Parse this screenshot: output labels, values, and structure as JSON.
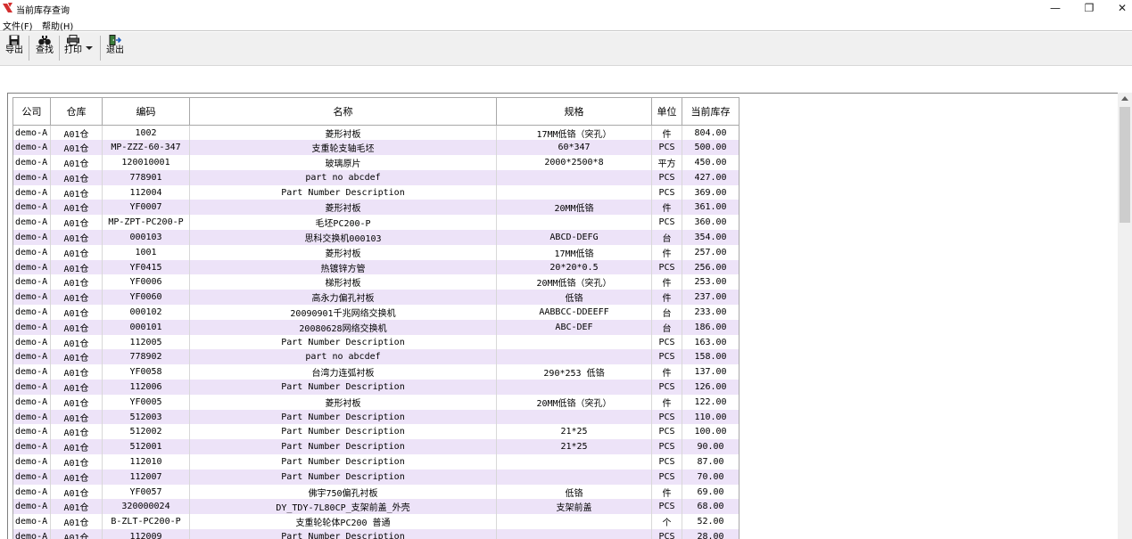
{
  "window": {
    "title": "当前库存查询",
    "minimize": "—",
    "maximize": "❐",
    "close": "✕"
  },
  "menu": [
    {
      "label": "文件(F)"
    },
    {
      "label": "帮助(H)"
    }
  ],
  "toolbar": {
    "export_label": "导出",
    "find_label": "查找",
    "print_label": "打印",
    "exit_label": "退出"
  },
  "table": {
    "columns": [
      "公司",
      "仓库",
      "编码",
      "名称",
      "规格",
      "单位",
      "当前库存"
    ],
    "rows": [
      [
        "demo-A",
        "A01仓",
        "1002",
        "菱形衬板",
        "17MM低铬（突孔）",
        "件",
        "804.00"
      ],
      [
        "demo-A",
        "A01仓",
        "MP-ZZZ-60-347",
        "支重轮支轴毛坯",
        "60*347",
        "PCS",
        "500.00"
      ],
      [
        "demo-A",
        "A01仓",
        "120010001",
        "玻璃原片",
        "2000*2500*8",
        "平方",
        "450.00"
      ],
      [
        "demo-A",
        "A01仓",
        "778901",
        "part no abcdef",
        "",
        "PCS",
        "427.00"
      ],
      [
        "demo-A",
        "A01仓",
        "112004",
        "Part Number Description",
        "",
        "PCS",
        "369.00"
      ],
      [
        "demo-A",
        "A01仓",
        "YF0007",
        "菱形衬板",
        "20MM低铬",
        "件",
        "361.00"
      ],
      [
        "demo-A",
        "A01仓",
        "MP-ZPT-PC200-P",
        "毛坯PC200-P",
        "",
        "PCS",
        "360.00"
      ],
      [
        "demo-A",
        "A01仓",
        "000103",
        "思科交换机000103",
        "ABCD-DEFG",
        "台",
        "354.00"
      ],
      [
        "demo-A",
        "A01仓",
        "1001",
        "菱形衬板",
        "17MM低铬",
        "件",
        "257.00"
      ],
      [
        "demo-A",
        "A01仓",
        "YF0415",
        "热镀锌方管",
        "20*20*0.5",
        "PCS",
        "256.00"
      ],
      [
        "demo-A",
        "A01仓",
        "YF0006",
        "梯形衬板",
        "20MM低铬（突孔）",
        "件",
        "253.00"
      ],
      [
        "demo-A",
        "A01仓",
        "YF0060",
        "高永力偏孔衬板",
        "低铬",
        "件",
        "237.00"
      ],
      [
        "demo-A",
        "A01仓",
        "000102",
        "20090901千兆网络交换机",
        "AABBCC-DDEEFF",
        "台",
        "233.00"
      ],
      [
        "demo-A",
        "A01仓",
        "000101",
        "20080628网络交换机",
        "ABC-DEF",
        "台",
        "186.00"
      ],
      [
        "demo-A",
        "A01仓",
        "112005",
        "Part Number Description",
        "",
        "PCS",
        "163.00"
      ],
      [
        "demo-A",
        "A01仓",
        "778902",
        "part no abcdef",
        "",
        "PCS",
        "158.00"
      ],
      [
        "demo-A",
        "A01仓",
        "YF0058",
        "台湾力连弧衬板",
        "290*253 低铬",
        "件",
        "137.00"
      ],
      [
        "demo-A",
        "A01仓",
        "112006",
        "Part Number Description",
        "",
        "PCS",
        "126.00"
      ],
      [
        "demo-A",
        "A01仓",
        "YF0005",
        "菱形衬板",
        "20MM低铬（突孔）",
        "件",
        "122.00"
      ],
      [
        "demo-A",
        "A01仓",
        "512003",
        "Part Number Description",
        "",
        "PCS",
        "110.00"
      ],
      [
        "demo-A",
        "A01仓",
        "512002",
        "Part Number Description",
        "21*25",
        "PCS",
        "100.00"
      ],
      [
        "demo-A",
        "A01仓",
        "512001",
        "Part Number Description",
        "21*25",
        "PCS",
        "90.00"
      ],
      [
        "demo-A",
        "A01仓",
        "112010",
        "Part Number Description",
        "",
        "PCS",
        "87.00"
      ],
      [
        "demo-A",
        "A01仓",
        "112007",
        "Part Number Description",
        "",
        "PCS",
        "70.00"
      ],
      [
        "demo-A",
        "A01仓",
        "YF0057",
        "佛宇750偏孔衬板",
        "低铬",
        "件",
        "69.00"
      ],
      [
        "demo-A",
        "A01仓",
        "320000024",
        "DY_TDY-7L80CP_支架前盖_外壳",
        "支架前盖",
        "PCS",
        "68.00"
      ],
      [
        "demo-A",
        "A01仓",
        "B-ZLT-PC200-P",
        "支重轮轮体PC200 普通",
        "",
        "个",
        "52.00"
      ],
      [
        "demo-A",
        "A01仓",
        "112009",
        "Part Number Description",
        "",
        "PCS",
        "28.00"
      ]
    ]
  },
  "colors": {
    "alt_row": "#ede3f8",
    "app_icon": "#d32f2f"
  }
}
